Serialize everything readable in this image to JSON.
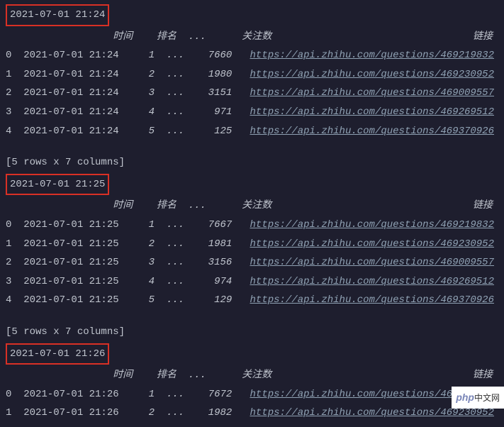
{
  "blocks": [
    {
      "timestamp": "2021-07-01 21:24",
      "headers": {
        "time": "时间",
        "rank": "排名",
        "dots": "...",
        "focus": "关注数",
        "link": "链接"
      },
      "rows": [
        {
          "idx": "0",
          "time": "2021-07-01 21:24",
          "rank": "1",
          "dots": "...",
          "focus": "7660",
          "url": "https://api.zhihu.com/questions/469219832"
        },
        {
          "idx": "1",
          "time": "2021-07-01 21:24",
          "rank": "2",
          "dots": "...",
          "focus": "1980",
          "url": "https://api.zhihu.com/questions/469230952"
        },
        {
          "idx": "2",
          "time": "2021-07-01 21:24",
          "rank": "3",
          "dots": "...",
          "focus": "3151",
          "url": "https://api.zhihu.com/questions/469009557"
        },
        {
          "idx": "3",
          "time": "2021-07-01 21:24",
          "rank": "4",
          "dots": "...",
          "focus": "971",
          "url": "https://api.zhihu.com/questions/469269512"
        },
        {
          "idx": "4",
          "time": "2021-07-01 21:24",
          "rank": "5",
          "dots": "...",
          "focus": "125",
          "url": "https://api.zhihu.com/questions/469370926"
        }
      ],
      "summary": "[5 rows x 7 columns]"
    },
    {
      "timestamp": "2021-07-01 21:25",
      "headers": {
        "time": "时间",
        "rank": "排名",
        "dots": "...",
        "focus": "关注数",
        "link": "链接"
      },
      "rows": [
        {
          "idx": "0",
          "time": "2021-07-01 21:25",
          "rank": "1",
          "dots": "...",
          "focus": "7667",
          "url": "https://api.zhihu.com/questions/469219832"
        },
        {
          "idx": "1",
          "time": "2021-07-01 21:25",
          "rank": "2",
          "dots": "...",
          "focus": "1981",
          "url": "https://api.zhihu.com/questions/469230952"
        },
        {
          "idx": "2",
          "time": "2021-07-01 21:25",
          "rank": "3",
          "dots": "...",
          "focus": "3156",
          "url": "https://api.zhihu.com/questions/469009557"
        },
        {
          "idx": "3",
          "time": "2021-07-01 21:25",
          "rank": "4",
          "dots": "...",
          "focus": "974",
          "url": "https://api.zhihu.com/questions/469269512"
        },
        {
          "idx": "4",
          "time": "2021-07-01 21:25",
          "rank": "5",
          "dots": "...",
          "focus": "129",
          "url": "https://api.zhihu.com/questions/469370926"
        }
      ],
      "summary": "[5 rows x 7 columns]"
    },
    {
      "timestamp": "2021-07-01 21:26",
      "headers": {
        "time": "时间",
        "rank": "排名",
        "dots": "...",
        "focus": "关注数",
        "link": "链接"
      },
      "rows": [
        {
          "idx": "0",
          "time": "2021-07-01 21:26",
          "rank": "1",
          "dots": "...",
          "focus": "7672",
          "url": "https://api.zhihu.com/questions/46921983"
        },
        {
          "idx": "1",
          "time": "2021-07-01 21:26",
          "rank": "2",
          "dots": "...",
          "focus": "1982",
          "url": "https://api.zhihu.com/questions/469230952"
        }
      ],
      "summary": ""
    }
  ],
  "watermark": {
    "php": "php",
    "cn": "中文网"
  }
}
